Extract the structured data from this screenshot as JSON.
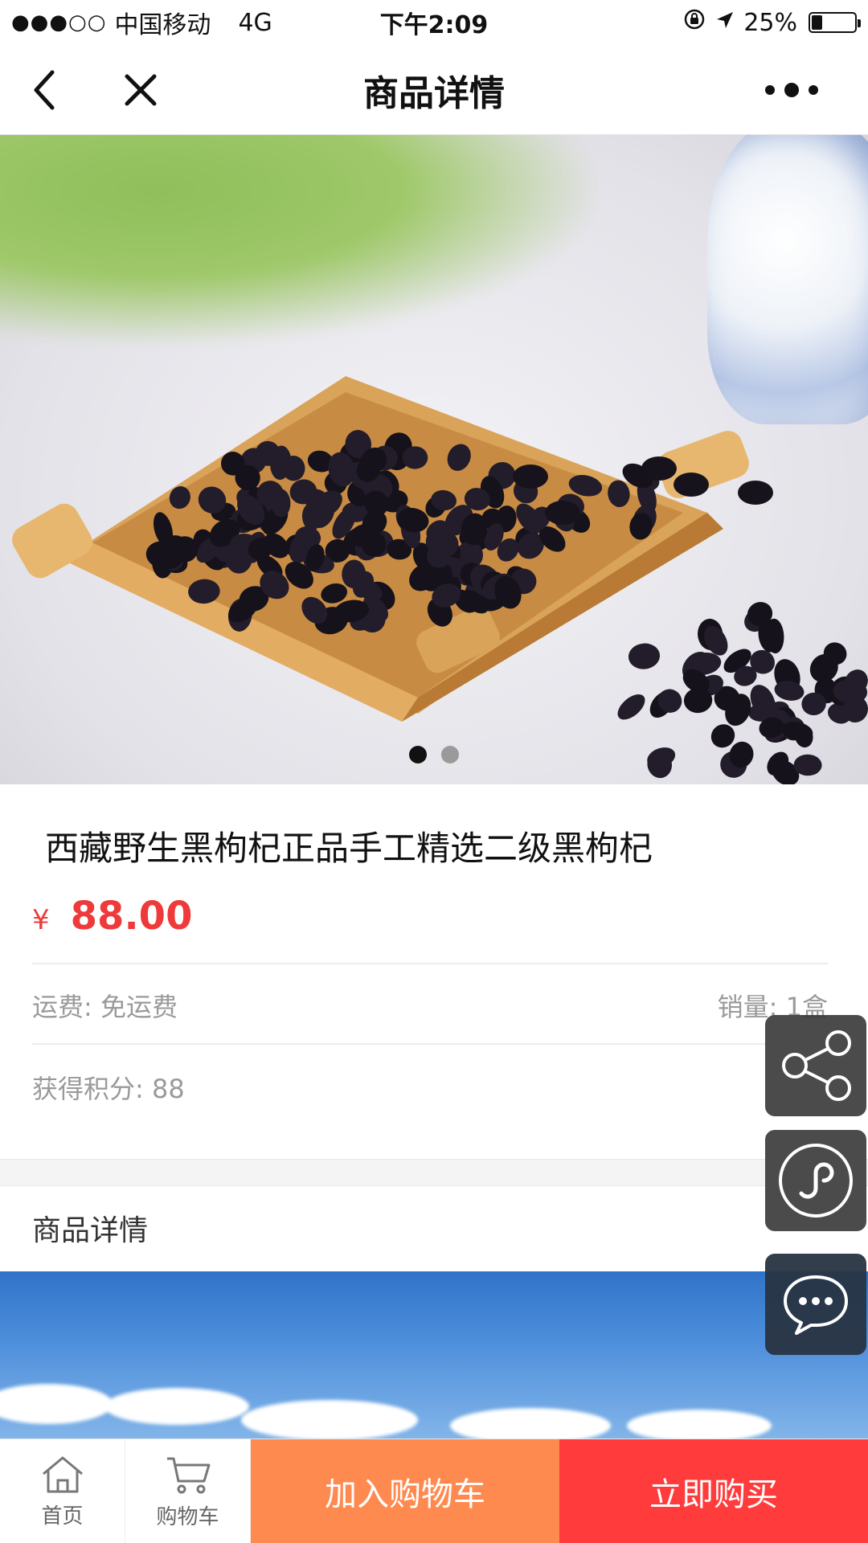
{
  "status_bar": {
    "signal": "●●●○○",
    "carrier": "中国移动",
    "network": "4G",
    "time": "下午2:09",
    "battery_percent": "25%",
    "battery_level": 0.25
  },
  "nav": {
    "title": "商品详情"
  },
  "carousel": {
    "total_slides": 2,
    "active_slide": 1
  },
  "product": {
    "title": "西藏野生黑枸杞正品手工精选二级黑枸杞",
    "currency_symbol": "¥",
    "price": "88.00",
    "shipping": "运费: 免运费",
    "sales": "销量: 1盒",
    "points": "获得积分: 88"
  },
  "details": {
    "section_title": "商品详情"
  },
  "floating_actions": [
    {
      "name": "share",
      "icon": "share-icon"
    },
    {
      "name": "mini-program",
      "icon": "link-icon"
    },
    {
      "name": "customer-service",
      "icon": "chat-icon"
    }
  ],
  "bottom_bar": {
    "home_label": "首页",
    "cart_label": "购物车",
    "add_to_cart_label": "加入购物车",
    "buy_now_label": "立即购买"
  },
  "colors": {
    "price": "#ee3a3a",
    "add_to_cart": "#ff8a50",
    "buy_now": "#ff3b3b"
  }
}
